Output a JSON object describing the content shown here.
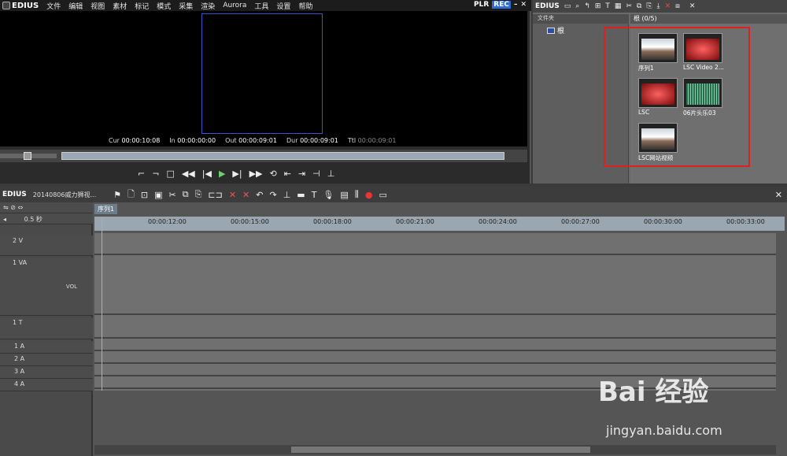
{
  "player": {
    "menu": [
      "文件",
      "编辑",
      "视图",
      "素材",
      "标记",
      "模式",
      "采集",
      "渲染",
      "Aurora",
      "工具",
      "设置",
      "帮助"
    ],
    "app_title": "EDIUS",
    "plr": "PLR",
    "rec": "REC",
    "timecodes": [
      {
        "label": "Cur",
        "value": "00:00:10:08"
      },
      {
        "label": "In",
        "value": "00:00:00:00"
      },
      {
        "label": "Out",
        "value": "00:00:09:01"
      },
      {
        "label": "Dur",
        "value": "00:00:09:01"
      },
      {
        "label": "Ttl",
        "value": "00:00:09:01"
      }
    ],
    "transport": [
      "set-in-icon",
      "set-out-icon",
      "stop-icon",
      "rewind-icon",
      "step-back-icon",
      "play-icon",
      "step-forward-icon",
      "fast-forward-icon",
      "loop-icon",
      "insert-icon",
      "overwrite-icon",
      "extract-icon",
      "lift-icon"
    ]
  },
  "bin": {
    "title": "EDIUS",
    "folder_header": "文件夹",
    "root_label": "根",
    "clip_header": "根 (0/5)",
    "clips": [
      {
        "name": "序列1",
        "thumb": "road",
        "icon": "sequence-icon"
      },
      {
        "name": "LSC Video 2...",
        "thumb": "red",
        "icon": "video-icon"
      },
      {
        "name": "LSC",
        "thumb": "red",
        "icon": "video-icon"
      },
      {
        "name": "06片头乐03",
        "thumb": "wave",
        "icon": "audio-icon"
      },
      {
        "name": "LSC网站视频",
        "thumb": "road",
        "icon": "video-icon"
      }
    ]
  },
  "timeline": {
    "title": "EDIUS",
    "project": "20140806威力狮视...",
    "sequence_tab": "序列1",
    "zoom": "0.5 秒",
    "ruler": [
      "00:00:12:00",
      "00:00:15:00",
      "00:00:18:00",
      "00:00:21:00",
      "00:00:24:00",
      "00:00:27:00",
      "00:00:30:00",
      "00:00:33:00"
    ],
    "tracks": [
      {
        "name": "2 V"
      },
      {
        "name": "1 VA"
      },
      {
        "name": "1 T"
      },
      {
        "name": "1 A"
      },
      {
        "name": "2 A"
      },
      {
        "name": "3 A"
      },
      {
        "name": "4 A"
      }
    ],
    "vol": "VOL"
  },
  "watermark": {
    "brand": "Bai 经验",
    "url": "jingyan.baidu.com"
  }
}
